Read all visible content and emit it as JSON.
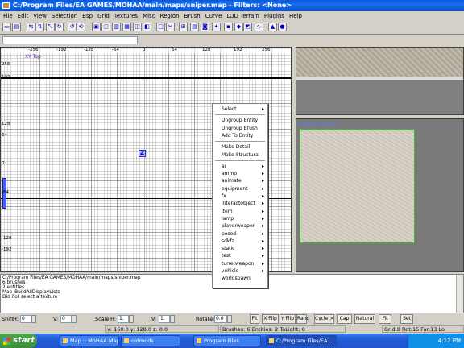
{
  "window": {
    "title": "C:/Program Files/EA GAMES/MOHAA/main/maps/sniper.map - Filters: <None>"
  },
  "menu": [
    "File",
    "Edit",
    "View",
    "Selection",
    "Bsp",
    "Grid",
    "Textures",
    "Misc",
    "Region",
    "Brush",
    "Curve",
    "LOD Terrain",
    "Plugins",
    "Help"
  ],
  "toolbar": {
    "icons": [
      "open-icon",
      "save-icon",
      "flip-x-icon",
      "flip-y-icon",
      "flip-z-icon",
      "rotate-x-icon",
      "rotate-y-icon",
      "rotate-z-icon",
      "select-complete-tall-icon",
      "select-touching-icon",
      "select-partial-tall-icon",
      "select-inside-icon",
      "csg-subtract-icon",
      "csg-merge-icon",
      "hollow-icon",
      "clipper-icon",
      "change-views-icon",
      "texture-view-icon",
      "camera-icon",
      "lock-icon",
      "cubic-clip-icon",
      "entity-view-icon",
      "patch-icon",
      "curve-icon",
      "letter-icons",
      "brush-icon"
    ]
  },
  "xyview": {
    "label": "XY Top",
    "xticks": [
      "-256",
      "-192",
      "-128",
      "-64",
      "0",
      "64",
      "128",
      "192",
      "256"
    ],
    "yticks": [
      "256",
      "192",
      "128",
      "64",
      "0",
      "-64",
      "-128",
      "-192"
    ],
    "entity_marker": "Z"
  },
  "texture_window": {
    "name": "[african_wall1a]"
  },
  "context_menu": {
    "items": [
      {
        "label": "Select",
        "submenu": true
      },
      {
        "sep": true
      },
      {
        "label": "Ungroup Entity"
      },
      {
        "label": "Ungroup Brush"
      },
      {
        "label": "Add To Entity"
      },
      {
        "sep": true
      },
      {
        "label": "Make Detail"
      },
      {
        "label": "Make Structural"
      },
      {
        "sep": true
      },
      {
        "label": "ai",
        "submenu": true
      },
      {
        "label": "ammo",
        "submenu": true
      },
      {
        "label": "animate",
        "submenu": true
      },
      {
        "label": "equipment",
        "submenu": true
      },
      {
        "label": "fx",
        "submenu": true
      },
      {
        "label": "interactobject",
        "submenu": true
      },
      {
        "label": "item",
        "submenu": true
      },
      {
        "label": "lamp",
        "submenu": true
      },
      {
        "label": "playerweapon",
        "submenu": true
      },
      {
        "label": "posed",
        "submenu": true
      },
      {
        "label": "sdkfz",
        "submenu": true
      },
      {
        "label": "static",
        "submenu": true
      },
      {
        "label": "test",
        "submenu": true
      },
      {
        "label": "turretweapon",
        "submenu": true
      },
      {
        "label": "vehicle",
        "submenu": true
      },
      {
        "label": "worldspawn"
      }
    ]
  },
  "console": {
    "lines": [
      "C:/Program Files/EA GAMES/MOHAA/main/maps/sniper.map",
      "   6 brushes",
      "   2 entities",
      "Map_BuildAllDisplayLists",
      "Did not select a texture"
    ]
  },
  "controls": {
    "shift_label": "Shift",
    "h_label": "H:",
    "shift_h": "0",
    "v_label": "V:",
    "shift_v": "0",
    "scale_label": "Scale",
    "scale_h_label": "H:",
    "scale_h": "1.",
    "scale_v_label": "V:",
    "scale_v": "1.",
    "rotate_label": "Rotate:",
    "rotate": "0.0",
    "buttons": [
      "Fit",
      "X Flip",
      "Y Flip",
      "Rand",
      "Cycle >",
      "Cap",
      "Natural",
      "Fit",
      "Set"
    ]
  },
  "status": {
    "coords": "x:  160.0  y:  128.0  z:  0.0",
    "counts": "Brushes: 6 Entities: 2 ToLight: 0",
    "grid": "Grid:8 Rot:15 Far:13 Lo"
  },
  "taskbar": {
    "start": "start",
    "items": [
      "Map :: MoHAA Mappi...",
      "oldmods",
      "Program Files",
      "C:/Program Files/EA ..."
    ],
    "active_index": 3,
    "clock": "4:12 PM"
  }
}
